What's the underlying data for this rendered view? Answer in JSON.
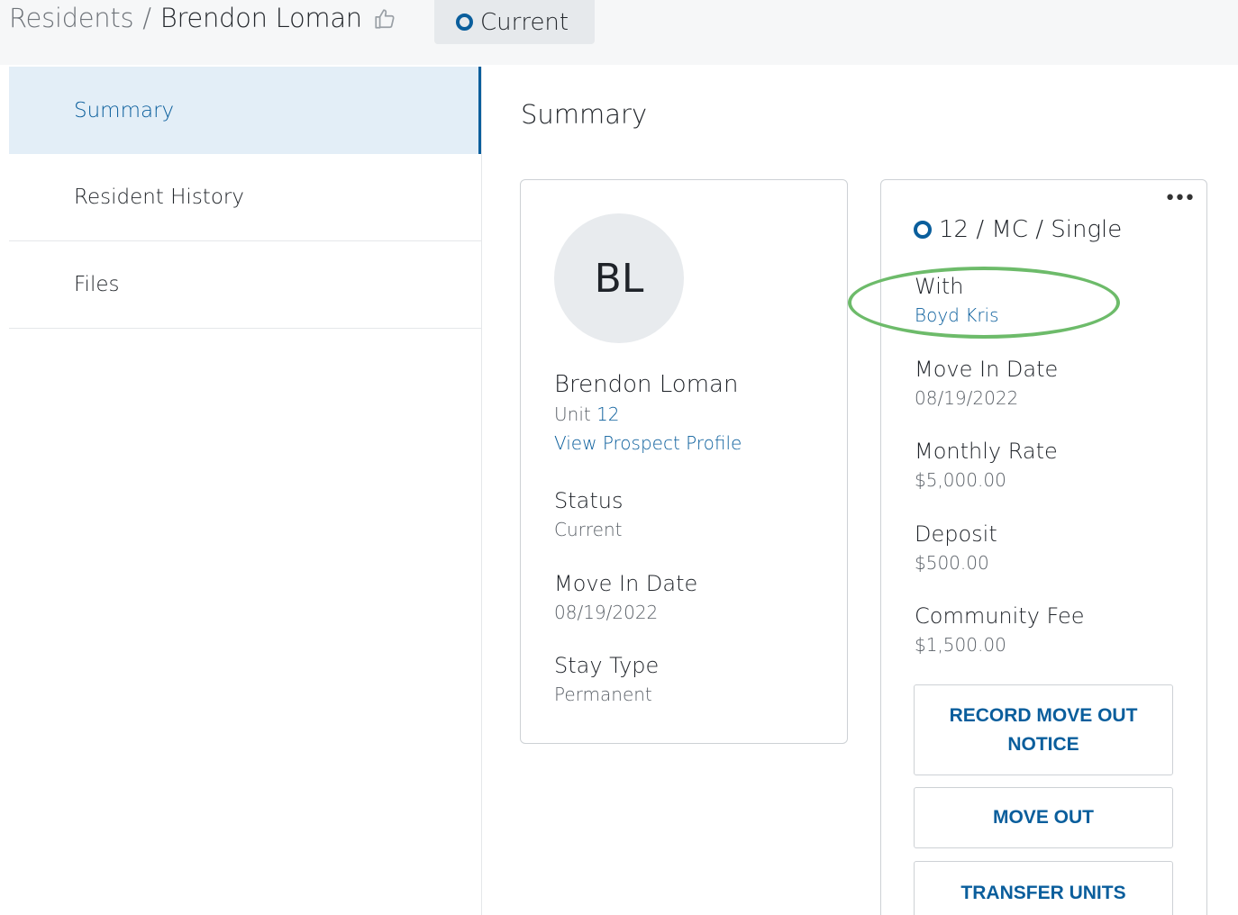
{
  "header": {
    "breadcrumb_root": "Residents",
    "breadcrumb_separator": "/",
    "breadcrumb_current": "Brendon Loman",
    "status_label": "Current"
  },
  "sidebar": {
    "items": [
      {
        "label": "Summary",
        "active": true
      },
      {
        "label": "Resident History",
        "active": false
      },
      {
        "label": "Files",
        "active": false
      }
    ]
  },
  "main": {
    "title": "Summary",
    "resident_card": {
      "initials": "BL",
      "name": "Brendon Loman",
      "unit_prefix": "Unit",
      "unit_number": "12",
      "profile_link": "View Prospect Profile",
      "fields": [
        {
          "label": "Status",
          "value": "Current"
        },
        {
          "label": "Move In Date",
          "value": "08/19/2022"
        },
        {
          "label": "Stay Type",
          "value": "Permanent"
        }
      ]
    },
    "unit_card": {
      "more_icon": "•••",
      "title": "12 / MC / Single",
      "with_label": "With",
      "with_value": "Boyd Kris",
      "fields": [
        {
          "label": "Move In Date",
          "value": "08/19/2022"
        },
        {
          "label": "Monthly Rate",
          "value": "$5,000.00"
        },
        {
          "label": "Deposit",
          "value": "$500.00"
        },
        {
          "label": "Community Fee",
          "value": "$1,500.00"
        }
      ],
      "buttons": {
        "record_move_out": "RECORD MOVE OUT NOTICE",
        "move_out": "MOVE OUT",
        "transfer_units": "TRANSFER UNITS"
      }
    }
  },
  "colors": {
    "accent": "#0a5e9c",
    "highlight": "#6dbb6a",
    "active_bg": "#e3eef7"
  }
}
